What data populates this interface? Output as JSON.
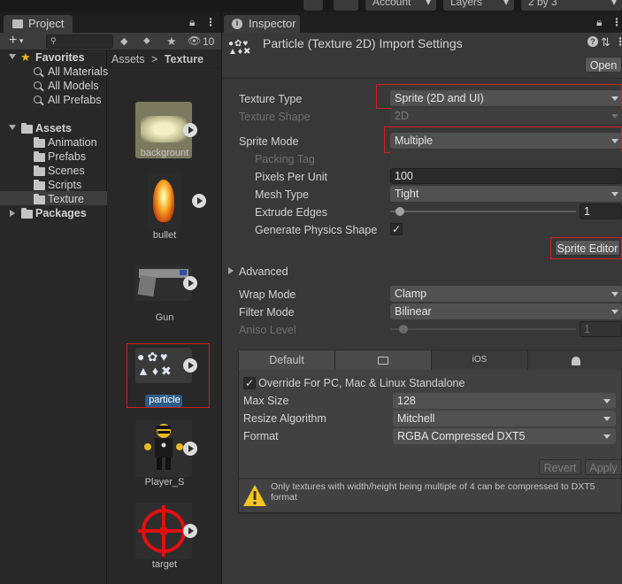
{
  "toolbar": {
    "account_label": "Account",
    "layers_label": "Layers",
    "layout_label": "2 by 3"
  },
  "project": {
    "tab_title": "Project",
    "hidden_count": "10",
    "search": {
      "placeholder": ""
    },
    "tree": {
      "favorites": "Favorites",
      "favorite_items": [
        "All Materials",
        "All Models",
        "All Prefabs"
      ],
      "assets": "Assets",
      "asset_folders": [
        "Animation",
        "Prefabs",
        "Scenes",
        "Scripts",
        "Texture"
      ],
      "packages": "Packages"
    },
    "breadcrumb": {
      "root": "Assets",
      "separator": ">",
      "current": "Texture"
    },
    "assets_grid": [
      "backgrount",
      "bullet",
      "Gun",
      "particle",
      "Player_S",
      "target"
    ]
  },
  "inspector": {
    "tab_title": "Inspector",
    "title": "Particle (Texture 2D) Import Settings",
    "open_label": "Open",
    "texture_type": {
      "label": "Texture Type",
      "value": "Sprite (2D and UI)"
    },
    "texture_shape": {
      "label": "Texture Shape",
      "value": "2D"
    },
    "sprite_mode": {
      "label": "Sprite Mode",
      "value": "Multiple"
    },
    "packing_tag": {
      "label": "Packing Tag",
      "value": ""
    },
    "pixels_per_unit": {
      "label": "Pixels Per Unit",
      "value": "100"
    },
    "mesh_type": {
      "label": "Mesh Type",
      "value": "Tight"
    },
    "extrude_edges": {
      "label": "Extrude Edges",
      "value": "1"
    },
    "generate_physics": {
      "label": "Generate Physics Shape",
      "checked": true,
      "mark": "✓"
    },
    "sprite_editor_label": "Sprite Editor",
    "advanced_label": "Advanced",
    "wrap_mode": {
      "label": "Wrap Mode",
      "value": "Clamp"
    },
    "filter_mode": {
      "label": "Filter Mode",
      "value": "Bilinear"
    },
    "aniso_level": {
      "label": "Aniso Level",
      "value": "1"
    },
    "platform_tabs": [
      "Default",
      "",
      "iOS",
      ""
    ],
    "override": {
      "label": "Override For PC, Mac & Linux Standalone",
      "checked": true,
      "mark": "✓"
    },
    "max_size": {
      "label": "Max Size",
      "value": "128"
    },
    "resize_algorithm": {
      "label": "Resize Algorithm",
      "value": "Mitchell"
    },
    "format": {
      "label": "Format",
      "value": "RGBA Compressed DXT5"
    },
    "revert_label": "Revert",
    "apply_label": "Apply",
    "warning": "Only textures with width/height being multiple of 4 can be compressed to DXT5 format"
  },
  "colors": {
    "highlight": "#d21f1f",
    "selection": "#2c5d87",
    "warning": "#f2c61f"
  }
}
